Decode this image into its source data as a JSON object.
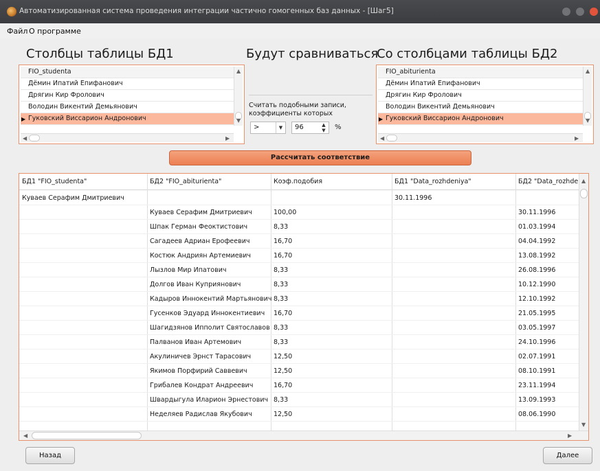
{
  "window": {
    "title": "Автоматизированная система проведения интеграции частично гомогенных баз данных - [Шаг5]"
  },
  "menu": {
    "file": "Файл",
    "about": "О программе"
  },
  "left": {
    "heading": "Столбцы таблицы БД1",
    "items": [
      "FIO_studenta",
      "Дёмин Ипатий Епифанович",
      "Дрягин Кир Фролович",
      "Володин Викентий Демьянович",
      "Гуковский Виссарион Андронович"
    ],
    "selected_index": 4
  },
  "middle": {
    "heading": "Будут сравниваться",
    "condition_label": "Считать подобными записи, коэффициенты которых",
    "operator": ">",
    "threshold": "96",
    "unit": "%"
  },
  "right": {
    "heading": "Со столбцами таблицы БД2",
    "items": [
      "FIO_abiturienta",
      "Дёмин Ипатий Епифанович",
      "Дрягин Кир Фролович",
      "Володин Викентий Демьянович",
      "Гуковский Виссарион Андронович"
    ],
    "selected_index": 4
  },
  "calc_button": "Рассчитать соответствие",
  "table": {
    "columns": [
      "БД1 \"FIO_studenta\"",
      "БД2 \"FIO_abiturienta\"",
      "Коэф.подобия",
      "БД1 \"Data_rozhdeniya\"",
      "БД2 \"Data_rozhde"
    ],
    "rows": [
      [
        "Куваев Серафим Дмитриевич",
        "",
        "",
        "30.11.1996",
        ""
      ],
      [
        "",
        "Куваев Серафим Дмитриевич",
        "100,00",
        "",
        "30.11.1996"
      ],
      [
        "",
        "Шпак Герман Феоктистович",
        "8,33",
        "",
        "01.03.1994"
      ],
      [
        "",
        "Сагадеев Адриан Ерофеевич",
        "16,70",
        "",
        "04.04.1992"
      ],
      [
        "",
        "Костюк Андриян Артемиевич",
        "16,70",
        "",
        "13.08.1992"
      ],
      [
        "",
        "Лызлов Мир Ипатович",
        "8,33",
        "",
        "26.08.1996"
      ],
      [
        "",
        "Долгов Иван Куприянович",
        "8,33",
        "",
        "10.12.1990"
      ],
      [
        "",
        "Кадыров Иннокентий Мартьянович",
        "8,33",
        "",
        "12.10.1992"
      ],
      [
        "",
        "Гусенков Эдуард Иннокентиевич",
        "16,70",
        "",
        "21.05.1995"
      ],
      [
        "",
        "Шагидзянов Ипполит Святославов",
        "8,33",
        "",
        "03.05.1997"
      ],
      [
        "",
        "Палванов Иван Артемович",
        "8,33",
        "",
        "24.10.1996"
      ],
      [
        "",
        "Акулиничев Эрнст Тарасович",
        "12,50",
        "",
        "02.07.1991"
      ],
      [
        "",
        "Якимов Порфирий Саввевич",
        "12,50",
        "",
        "08.10.1991"
      ],
      [
        "",
        "Грибалев Кондрат Андреевич",
        "16,70",
        "",
        "23.11.1994"
      ],
      [
        "",
        "Швардыгула Иларион Эрнестович",
        "8,33",
        "",
        "13.09.1993"
      ],
      [
        "",
        "Неделяев Радислав Якубович",
        "12,50",
        "",
        "08.06.1990"
      ]
    ]
  },
  "buttons": {
    "back": "Назад",
    "next": "Далее"
  },
  "colors": {
    "accent": "#ec7f53",
    "selection": "#fbb89d",
    "close": "#e2553c"
  }
}
